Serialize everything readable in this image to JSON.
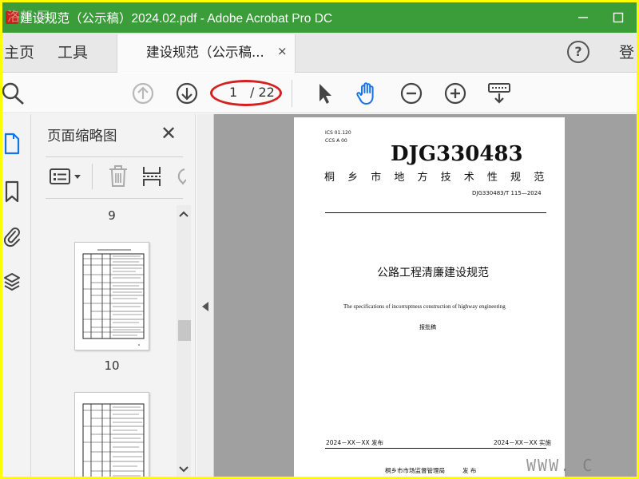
{
  "window": {
    "title": "建设规范（公示稿）2024.02.pdf - Adobe Acrobat Pro DC",
    "watermark_top": "洛邦 网"
  },
  "tabs": {
    "home": "主页",
    "tools": "工具",
    "document": "建设规范（公示稿...",
    "close": "×",
    "help": "?",
    "signin": "登"
  },
  "toolbar": {
    "current_page": "1",
    "total_pages": "/ 22",
    "icons": [
      "search-icon",
      "page-up-icon",
      "page-down-icon",
      "select-cursor-icon",
      "hand-tool-icon",
      "zoom-out-icon",
      "zoom-in-icon",
      "keyboard-scroll-icon"
    ]
  },
  "rail": {
    "icons": [
      "page-thumbnails-icon",
      "bookmarks-icon",
      "attachments-icon",
      "layers-icon"
    ]
  },
  "panel": {
    "title": "页面缩略图",
    "close": "✕",
    "page_labels": [
      "9",
      "10"
    ]
  },
  "document": {
    "ics": "ICS 01.120",
    "ccs": "CCS A 00",
    "code": "DJG330483",
    "region": "桐 乡 市 地 方 技 术 性 规 范",
    "number": "DJG330483/T 115—2024",
    "title_cn": "公路工程清廉建设规范",
    "title_en": "The specifications of incorruptness construction of highway engineering",
    "draft": "报批稿",
    "publish_date": "2024－XX－XX 发布",
    "implement_date": "2024－XX－XX 实施",
    "issuer": "桐乡市市场监督管理局",
    "issue_word": "发 布"
  },
  "watermark": "WWW. C"
}
